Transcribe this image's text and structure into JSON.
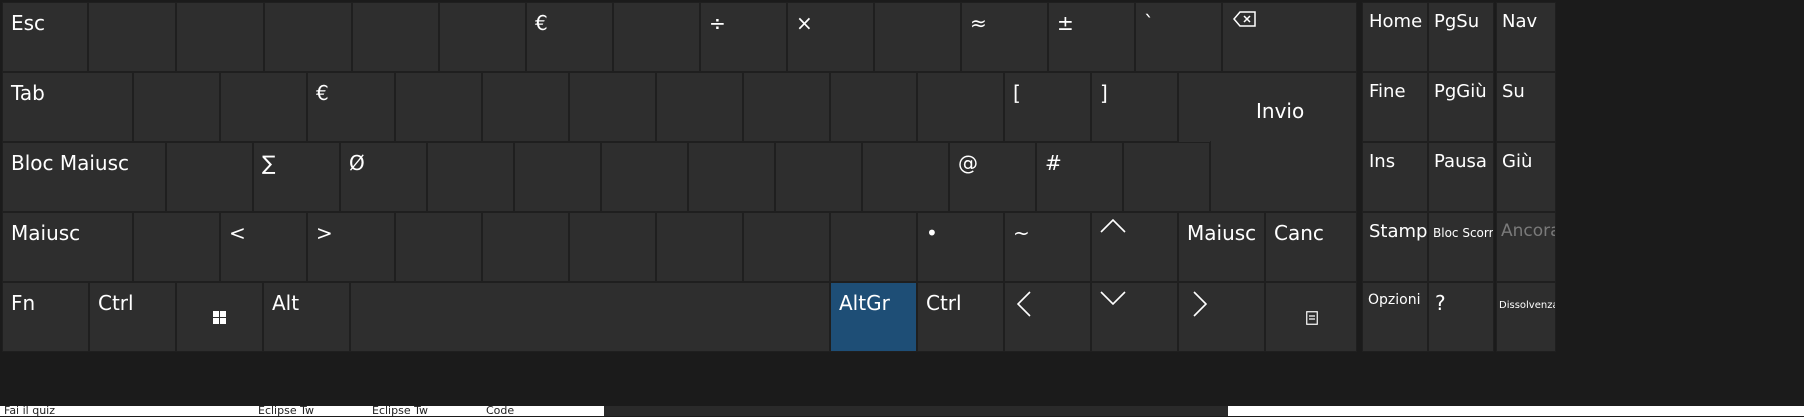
{
  "keyboard": {
    "row1": {
      "esc": "Esc",
      "euro": "€",
      "divide": "÷",
      "multiply": "×",
      "approx": "≈",
      "plusminus": "±",
      "grave": "`",
      "backspace_icon": "backspace-icon"
    },
    "row2": {
      "tab": "Tab",
      "euro": "€",
      "lbracket": "[",
      "rbracket": "]",
      "enter": "Invio"
    },
    "row3": {
      "capslock": "Bloc Maiusc",
      "sigma": "∑",
      "oslash": "Ø",
      "at": "@",
      "hash": "#"
    },
    "row4": {
      "shift_left": "Maiusc",
      "lt": "<",
      "gt": ">",
      "bullet": "•",
      "tilde": "~",
      "shift_right": "Maiusc",
      "del": "Canc"
    },
    "row5": {
      "fn": "Fn",
      "ctrl_left": "Ctrl",
      "alt": "Alt",
      "altgr": "AltGr",
      "ctrl_right": "Ctrl"
    },
    "nav": {
      "home": "Home",
      "pgup": "PgSu",
      "nav": "Nav",
      "end": "Fine",
      "pgdn": "PgGiù",
      "up": "Su",
      "ins": "Ins",
      "pause": "Pausa",
      "down": "Giù",
      "print": "Stamp",
      "scrolllock": "Bloc Scorr",
      "dock": "Ancora",
      "options": "Opzioni",
      "help": "?",
      "fade": "Dissolvenza"
    }
  },
  "background": {
    "frag1": "Fai il quiz",
    "frag2": "Eclipse Tw",
    "frag3": "Eclipse Tw",
    "frag4": "Code"
  },
  "colors": {
    "key": "#2e2e2e",
    "active": "#1e4e76",
    "bg": "#1b1b1b"
  }
}
